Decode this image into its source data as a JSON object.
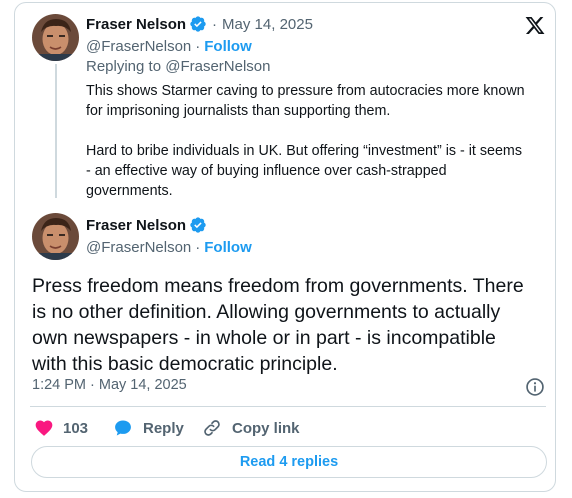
{
  "reply": {
    "author_name": "Fraser Nelson",
    "date": "May 14, 2025",
    "handle": "@FraserNelson",
    "follow_label": "Follow",
    "replying_to": "Replying to @FraserNelson",
    "paragraph1_line1": "This shows Starmer caving to pressure from autocracies more known",
    "paragraph1_line2": "for imprisoning journalists than supporting them.",
    "paragraph2_line1": "Hard to bribe individuals in UK. But offering “investment” is - it seems",
    "paragraph2_line2": "- an effective way of buying influence over cash-strapped",
    "paragraph2_line3": "governments."
  },
  "main": {
    "author_name": "Fraser Nelson",
    "handle": "@FraserNelson",
    "follow_label": "Follow",
    "text_line1": "Press freedom means freedom from governments. There",
    "text_line2": "is no other definition. Allowing governments to actually",
    "text_line3": "own newspapers - in whole or in part - is incompatible",
    "text_line4": "with this basic democratic principle.",
    "timestamp": "1:24 PM · May 14, 2025"
  },
  "actions": {
    "like_count": "103",
    "reply_label": "Reply",
    "copy_link_label": "Copy link"
  },
  "read_replies_label": "Read 4 replies",
  "colors": {
    "accent": "#1d9bf0",
    "like": "#f91880",
    "text": "#0f1419",
    "muted": "#536471",
    "border": "#cfd9de"
  },
  "icons": [
    "x-logo-icon",
    "verified-badge-icon",
    "heart-icon",
    "reply-bubble-icon",
    "link-icon",
    "info-icon"
  ]
}
